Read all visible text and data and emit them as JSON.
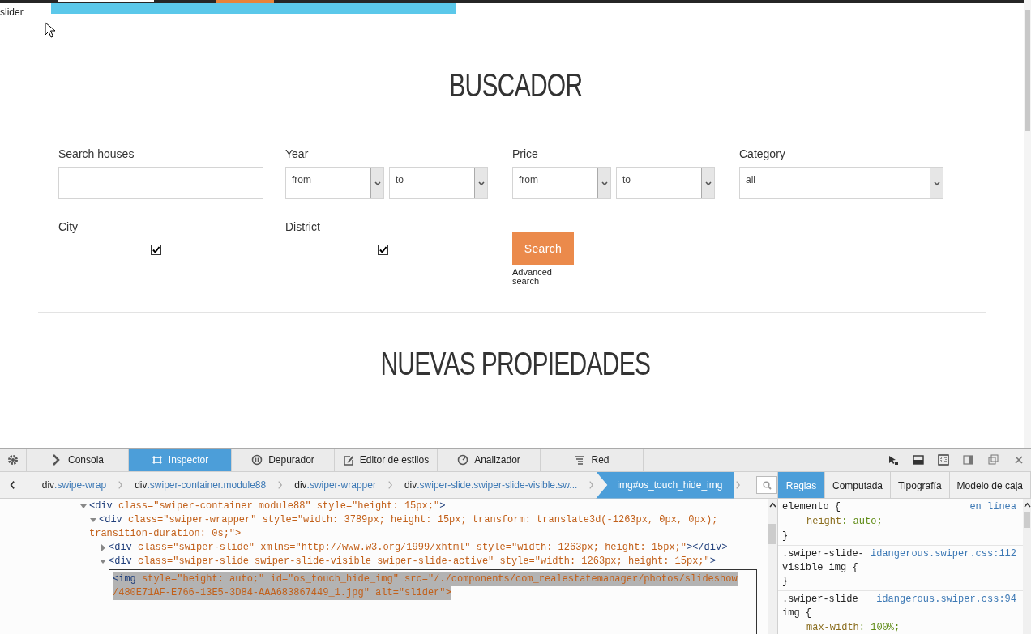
{
  "page": {
    "slider_alt": "slider",
    "heading": "BUSCADOR",
    "fields": [
      {
        "kind": "text",
        "label": "Search houses"
      },
      {
        "kind": "range",
        "label": "Year",
        "from": "from",
        "to": "to"
      },
      {
        "kind": "range",
        "label": "Price",
        "from": "from",
        "to": "to"
      },
      {
        "kind": "select",
        "label": "Category",
        "value": "all"
      },
      {
        "kind": "checkbox",
        "label": "City",
        "checked": true
      },
      {
        "kind": "checkbox",
        "label": "District",
        "checked": true
      },
      {
        "kind": "button",
        "label": "Search",
        "link": "Advanced search"
      }
    ],
    "section_title": "NUEVAS PROPIEDADES"
  },
  "devtools": {
    "tabs": [
      {
        "label": "Consola",
        "selected": false
      },
      {
        "label": "Inspector",
        "selected": true
      },
      {
        "label": "Depurador",
        "selected": false
      },
      {
        "label": "Editor de estilos",
        "selected": false
      },
      {
        "label": "Analizador",
        "selected": false
      },
      {
        "label": "Red",
        "selected": false
      }
    ],
    "breadcrumbs": [
      {
        "tag": "div",
        "rest": ".swipe-wrap",
        "selected": false
      },
      {
        "tag": "div",
        "rest": ".swiper-container.module88",
        "selected": false
      },
      {
        "tag": "div",
        "rest": ".swiper-wrapper",
        "selected": false
      },
      {
        "tag": "div",
        "rest": ".swiper-slide.swiper-slide-visible.sw...",
        "selected": false
      },
      {
        "tag": "img",
        "rest": "#os_touch_hide_img",
        "selected": true
      }
    ],
    "markup": [
      {
        "lines": [
          "<div class=\"swiper-container module88\" style=\"height: 15px;\">"
        ],
        "expanded": true,
        "selected": false,
        "children": [
          {
            "lines": [
              "<div class=\"swiper-wrapper\" style=\"width: 3789px; height: 15px; transform: translate3d(-1263px, 0px, 0px);",
              "transition-duration: 0s;\">"
            ],
            "expanded": true,
            "selected": false,
            "children": [
              {
                "lines": [
                  "<div class=\"swiper-slide\" xmlns=\"http://www.w3.org/1999/xhtml\" style=\"width: 1263px; height: 15px;\"></div>"
                ],
                "expanded": false,
                "selected": false
              },
              {
                "lines": [
                  "<div class=\"swiper-slide swiper-slide-visible swiper-slide-active\" style=\"width: 1263px; height: 15px;\">"
                ],
                "expanded": true,
                "selected": false,
                "children": [
                  {
                    "lines": [
                      "<img style=\"height: auto;\" id=\"os_touch_hide_img\" src=\"/./components/com_realestatemanager/photos/slideshow",
                      "/480E71AF-E766-13E5-3D84-AAA683867449_1.jpg\" alt=\"slider\">"
                    ],
                    "selected": true
                  }
                ]
              }
            ]
          }
        ]
      }
    ],
    "side_tabs": [
      {
        "label": "Reglas",
        "selected": true
      },
      {
        "label": "Computada",
        "selected": false
      },
      {
        "label": "Tipografía",
        "selected": false
      },
      {
        "label": "Modelo de caja",
        "selected": false
      }
    ],
    "rules": [
      {
        "selector": [
          "elemento {"
        ],
        "source": "en línea",
        "declarations": [
          "height: auto;"
        ],
        "close": "}"
      },
      {
        "selector": [
          ".swiper-slide-",
          "visible img {"
        ],
        "source": "idangerous.swiper.css:112",
        "close": "}"
      },
      {
        "selector": [
          ".swiper-slide",
          "img {"
        ],
        "source": "idangerous.swiper.css:94",
        "declarations": [
          "max-width: 100%;"
        ]
      }
    ]
  }
}
